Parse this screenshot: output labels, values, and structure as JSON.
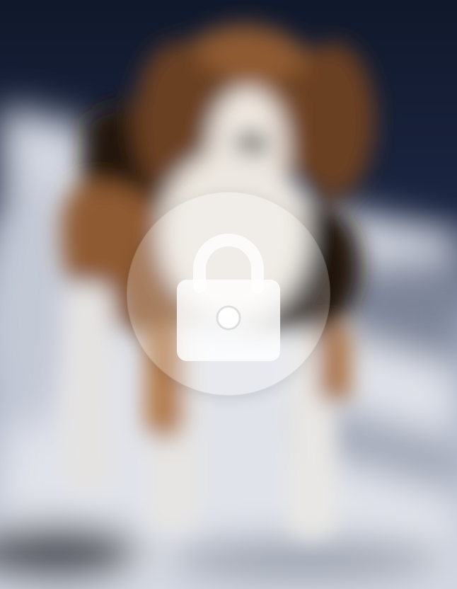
{
  "screen": {
    "state": "locked",
    "background_image": "blurred-beagle-photo",
    "colors": {
      "sky_dark": "#131a2e",
      "snow": "#d6dae4",
      "dog_brown": "#9a6338",
      "dog_black": "#24170f",
      "overlay": "rgba(255,255,255,0.22)"
    }
  },
  "lock": {
    "icon": "lock-icon"
  }
}
